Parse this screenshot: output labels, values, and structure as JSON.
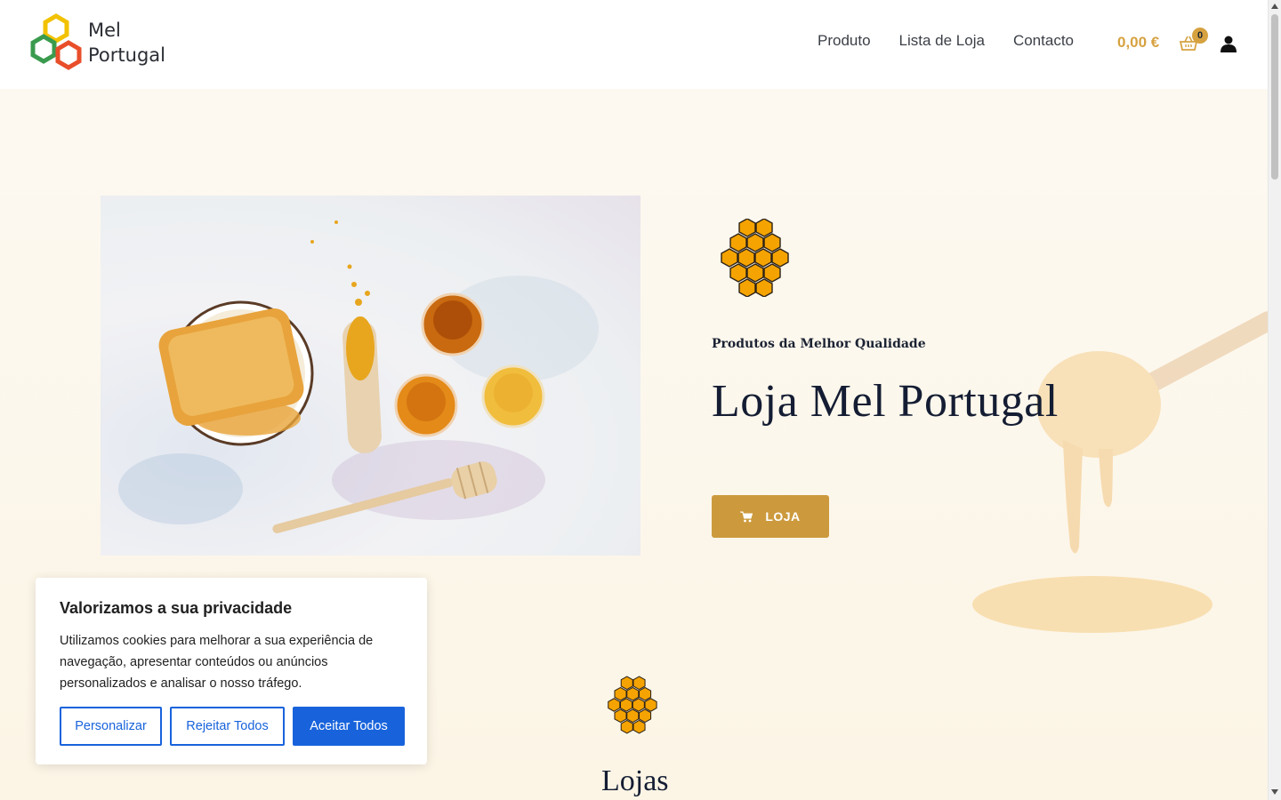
{
  "header": {
    "logo_line1": "Mel",
    "logo_line2": "Portugal",
    "nav": [
      {
        "label": "Produto"
      },
      {
        "label": "Lista de Loja"
      },
      {
        "label": "Contacto"
      }
    ],
    "cart_total": "0,00 €",
    "cart_count": "0",
    "icons": [
      "basket-icon",
      "user-icon"
    ]
  },
  "hero": {
    "subtitle": "Produtos da Melhor Qualidade",
    "title": "Loja Mel Portugal",
    "button_label": "LOJA",
    "button_icon": "cart-icon"
  },
  "section": {
    "title": "Lojas"
  },
  "cookie_banner": {
    "title": "Valorizamos a sua privacidade",
    "text": "Utilizamos cookies para melhorar a sua experiência de navegação, apresentar conteúdos ou anúncios personalizados e analisar o nosso tráfego.",
    "buttons": {
      "customize": "Personalizar",
      "reject": "Rejeitar Todos",
      "accept": "Aceitar Todos"
    }
  },
  "colors": {
    "accent": "#cc9a3d",
    "cart_text": "#d6a240",
    "cookie_blue": "#1863dc",
    "honey": "#f4a300",
    "hero_bg": "#fdf8ee"
  }
}
